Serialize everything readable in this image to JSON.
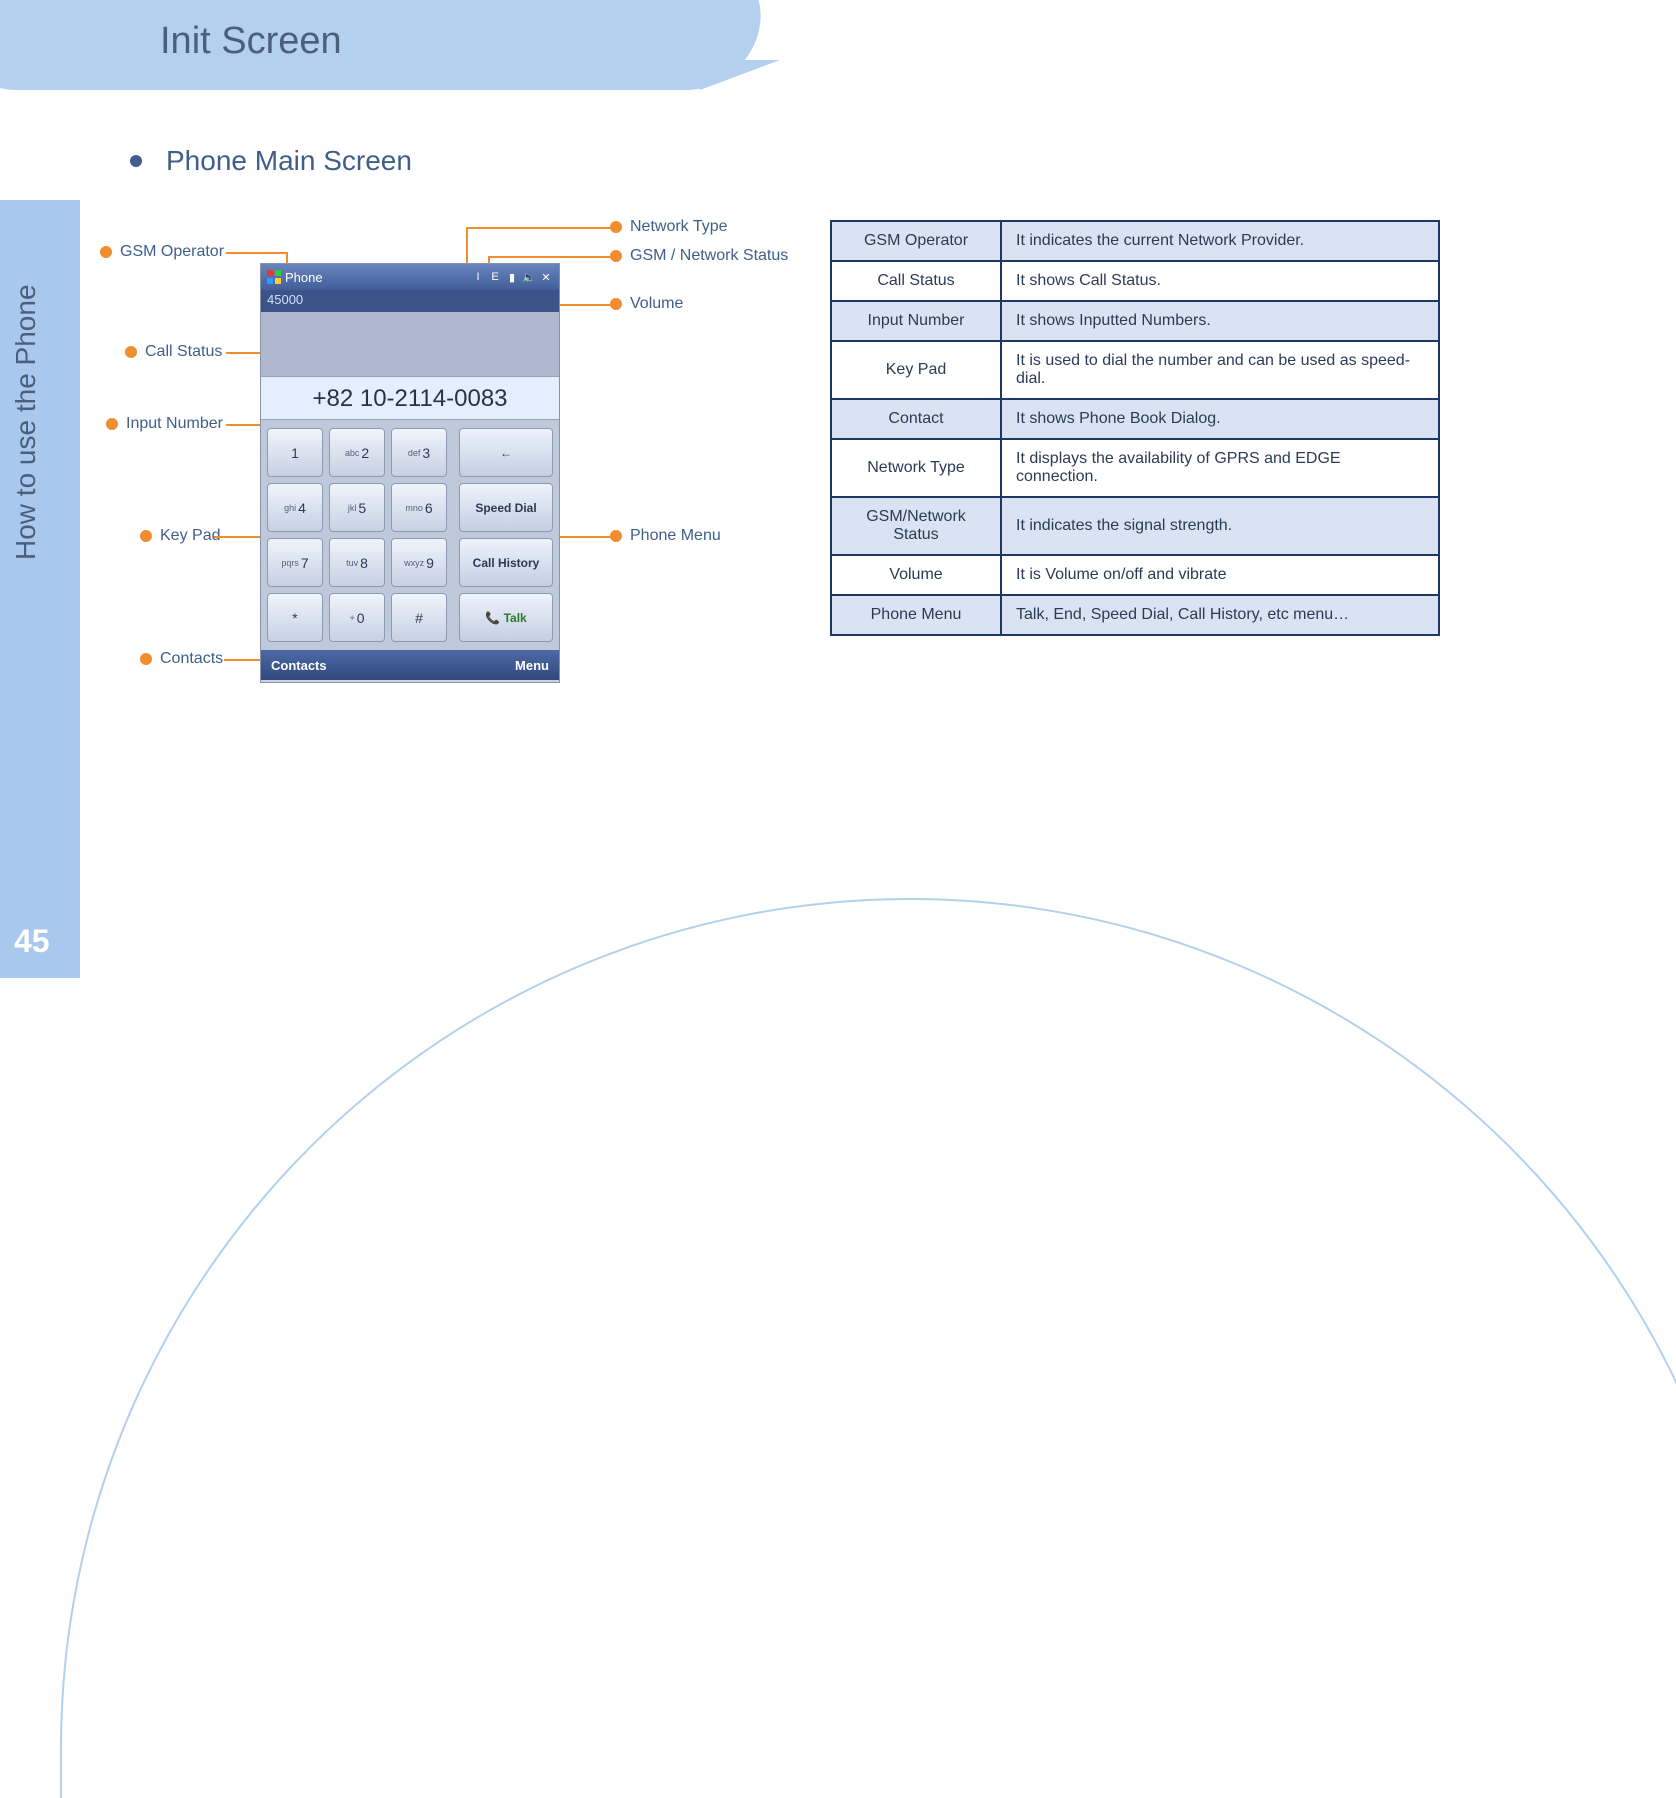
{
  "page": {
    "title": "Init Screen",
    "side_label": "How to use the Phone",
    "number": "45",
    "bullet": "Phone Main Screen"
  },
  "callouts": {
    "gsm_operator": "GSM Operator",
    "call_status": "Call Status",
    "input_number": "Input Number",
    "key_pad": "Key Pad",
    "contacts": "Contacts",
    "network_type": "Network Type",
    "gsm_network_status": "GSM / Network Status",
    "volume": "Volume",
    "phone_menu": "Phone Menu"
  },
  "phone": {
    "title": "Phone",
    "operator": "45000",
    "number": "+82 10-2114-0083",
    "keys": [
      {
        "sub": "",
        "main": "1"
      },
      {
        "sub": "abc",
        "main": "2"
      },
      {
        "sub": "def",
        "main": "3"
      },
      {
        "sub": "ghi",
        "main": "4"
      },
      {
        "sub": "jkl",
        "main": "5"
      },
      {
        "sub": "mno",
        "main": "6"
      },
      {
        "sub": "pqrs",
        "main": "7"
      },
      {
        "sub": "tuv",
        "main": "8"
      },
      {
        "sub": "wxyz",
        "main": "9"
      },
      {
        "sub": "",
        "main": "*"
      },
      {
        "sub": "+",
        "main": "0"
      },
      {
        "sub": "",
        "main": "#"
      }
    ],
    "menu_back": "←",
    "menu_speed": "Speed Dial",
    "menu_history": "Call History",
    "menu_talk": "Talk",
    "soft_left": "Contacts",
    "soft_right": "Menu",
    "icons": {
      "i": "I",
      "e": "E",
      "sig": "▮",
      "spk": "🔈",
      "x": "✕"
    }
  },
  "table": [
    {
      "name": "GSM Operator",
      "desc": "It indicates the current Network Provider."
    },
    {
      "name": "Call Status",
      "desc": "It shows Call Status."
    },
    {
      "name": "Input Number",
      "desc": "It shows Inputted Numbers."
    },
    {
      "name": "Key Pad",
      "desc": "It is used to dial the number and can be used as speed-dial."
    },
    {
      "name": "Contact",
      "desc": "It shows Phone Book Dialog."
    },
    {
      "name": "Network Type",
      "desc": "It displays the availability of GPRS and EDGE connection."
    },
    {
      "name": "GSM/Network Status",
      "desc": "It indicates the signal strength."
    },
    {
      "name": "Volume",
      "desc": "It is Volume on/off and vibrate"
    },
    {
      "name": "Phone Menu",
      "desc": "Talk, End, Speed Dial, Call History, etc menu…"
    }
  ]
}
